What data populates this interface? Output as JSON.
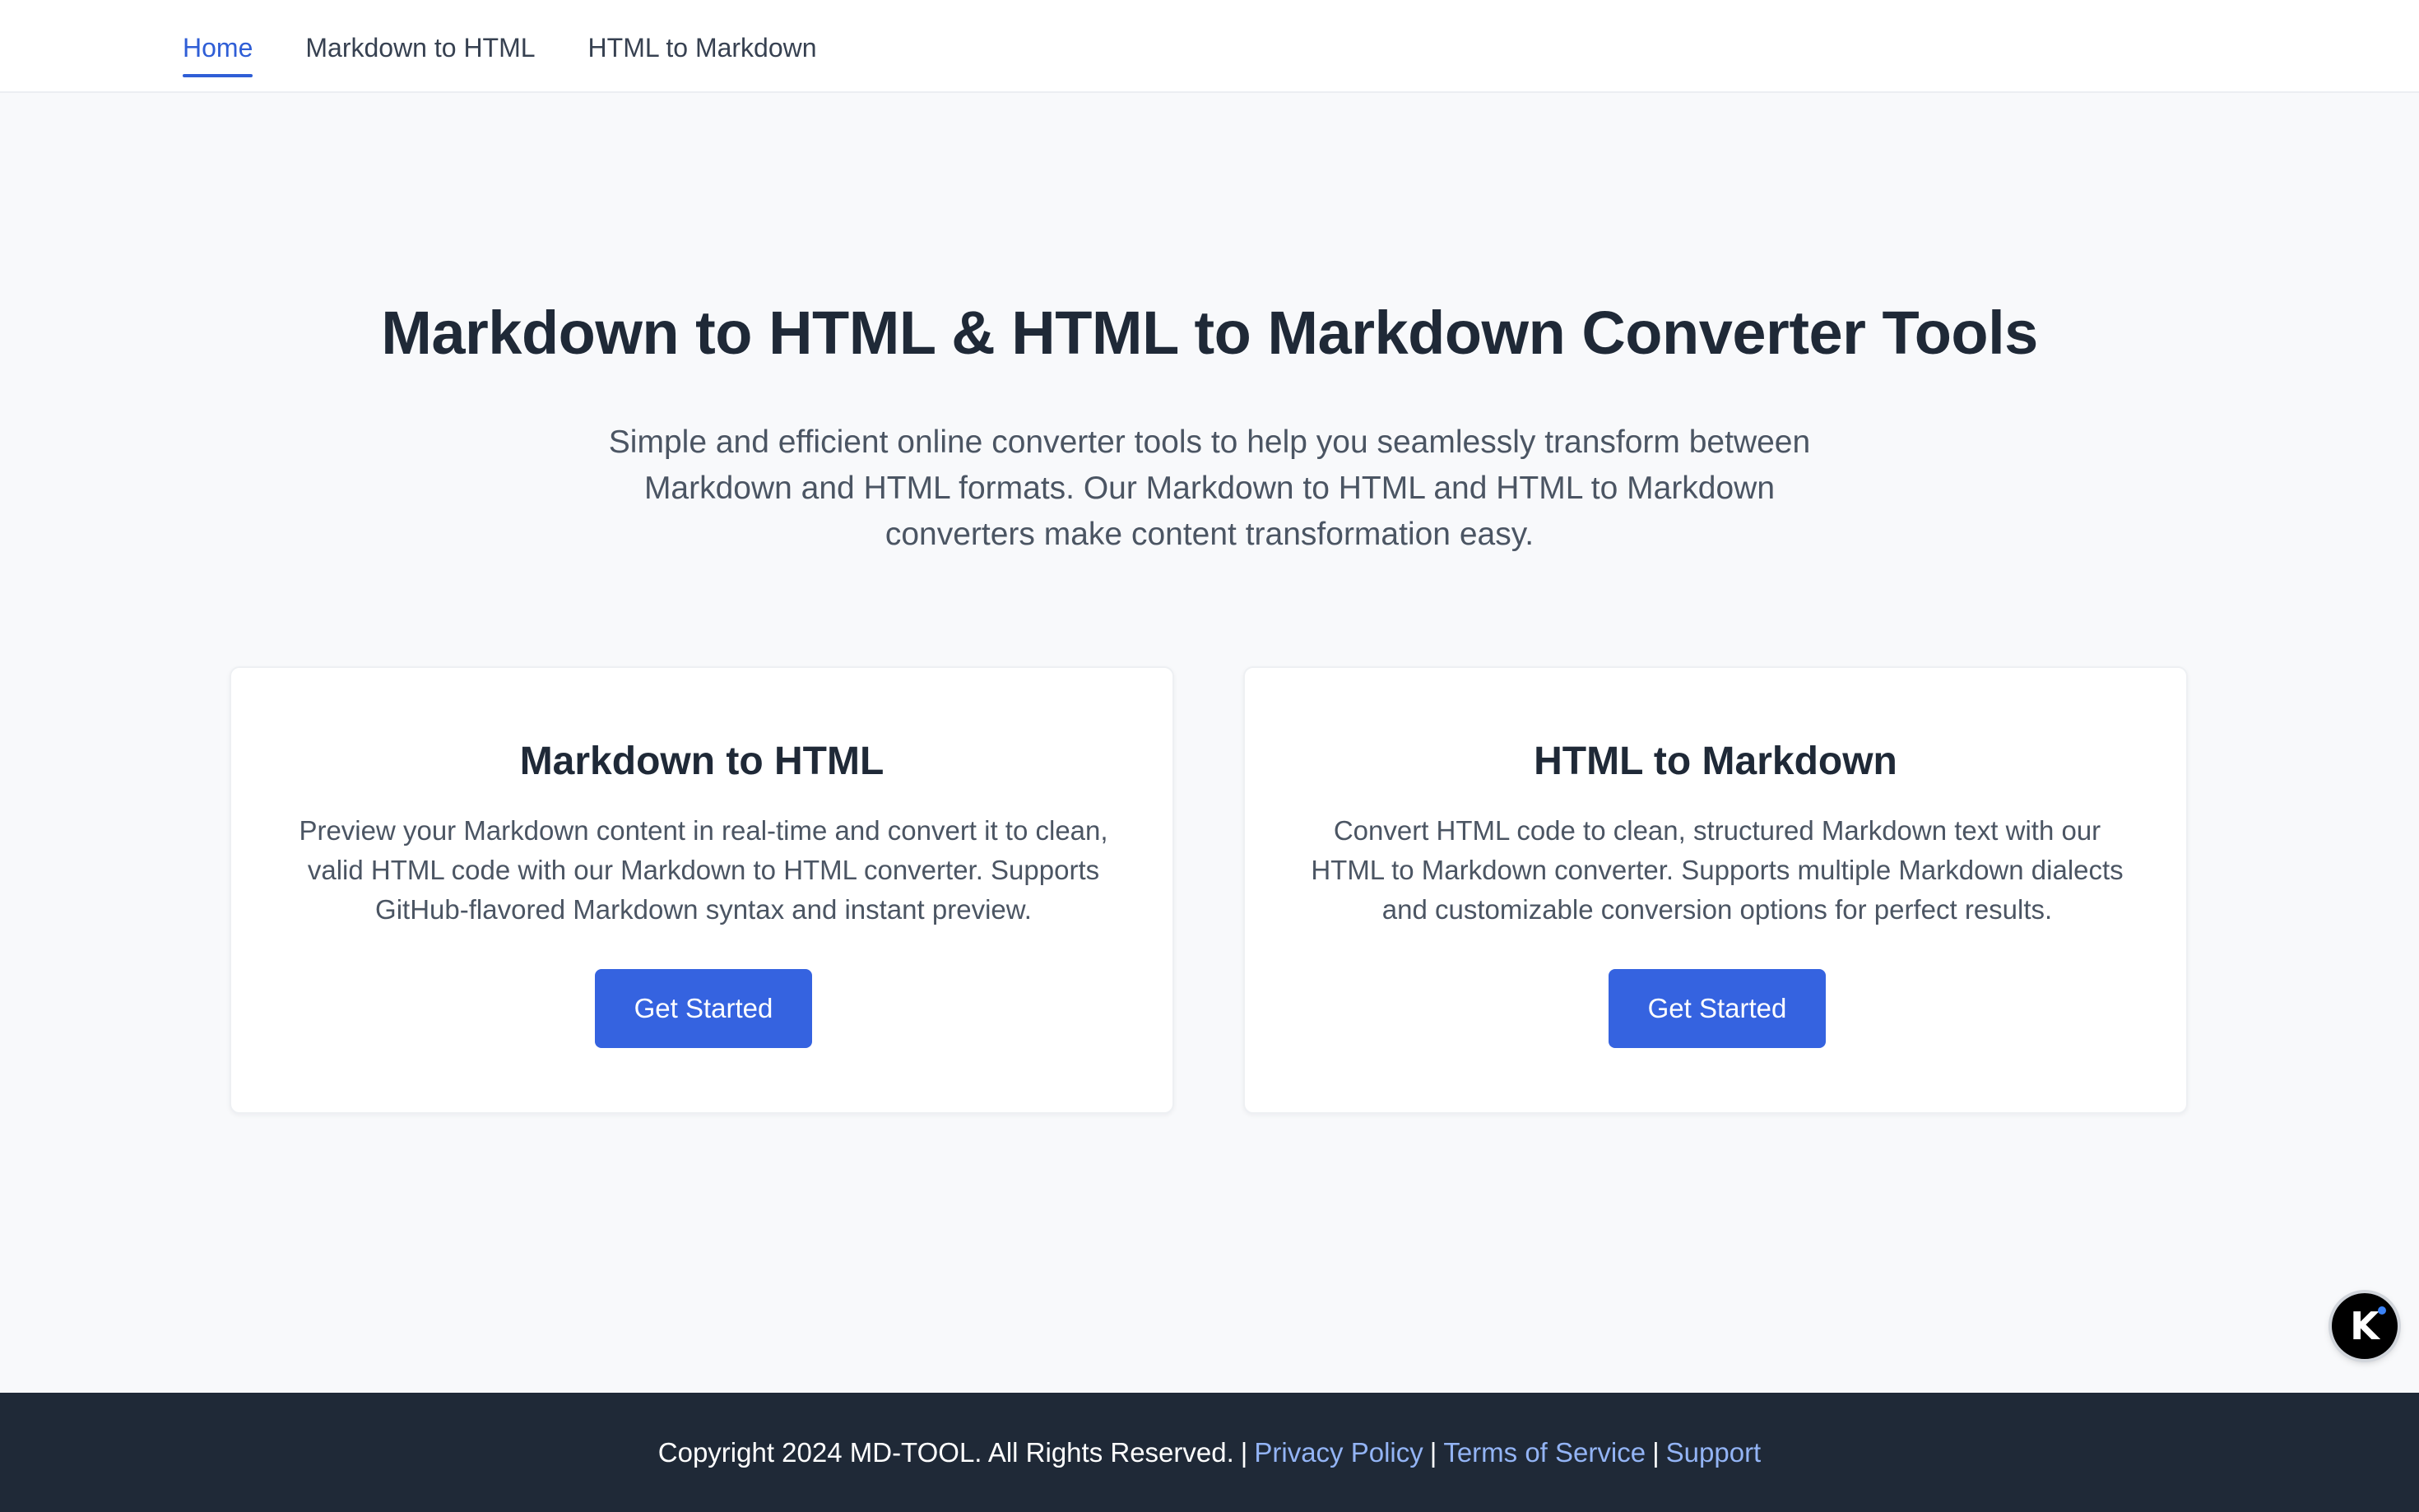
{
  "nav": {
    "items": [
      {
        "label": "Home",
        "active": true
      },
      {
        "label": "Markdown to HTML",
        "active": false
      },
      {
        "label": "HTML to Markdown",
        "active": false
      }
    ]
  },
  "hero": {
    "title": "Markdown to HTML & HTML to Markdown Converter Tools",
    "subtitle": "Simple and efficient online converter tools to help you seamlessly transform between Markdown and HTML formats. Our Markdown to HTML and HTML to Markdown converters make content transformation easy."
  },
  "cards": [
    {
      "title": "Markdown to HTML",
      "description": "Preview your Markdown content in real-time and convert it to clean, valid HTML code with our Markdown to HTML converter. Supports GitHub-flavored Markdown syntax and instant preview.",
      "button_label": "Get Started"
    },
    {
      "title": "HTML to Markdown",
      "description": "Convert HTML code to clean, structured Markdown text with our HTML to Markdown converter. Supports multiple Markdown dialects and customizable conversion options for perfect results.",
      "button_label": "Get Started"
    }
  ],
  "floating_badge": {
    "letter": "K",
    "icon": "k-logo-icon"
  },
  "footer": {
    "copyright": "Copyright 2024 MD-TOOL. All Rights Reserved.",
    "separator": "|",
    "links": [
      "Privacy Policy",
      "Terms of Service",
      "Support"
    ]
  },
  "colors": {
    "accent": "#2f5ed6",
    "button": "#3563e0",
    "footer_bg": "#1f2937",
    "footer_link": "#93b4f5",
    "page_bg": "#f8f9fb"
  }
}
